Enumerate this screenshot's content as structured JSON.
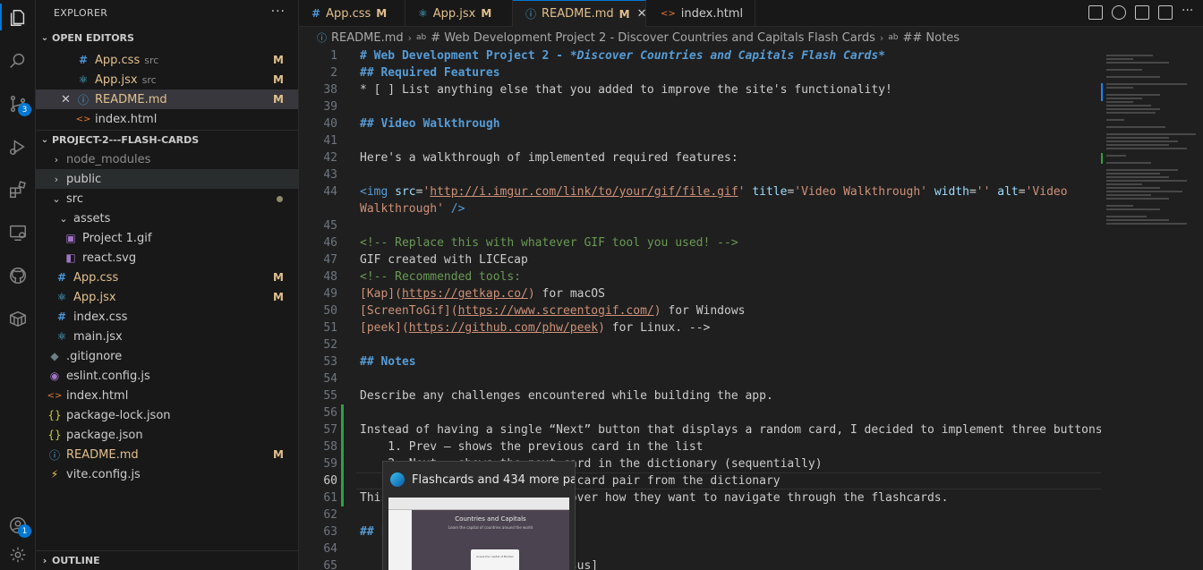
{
  "sidebar": {
    "title": "EXPLORER",
    "more": "···",
    "open_editors": {
      "title": "OPEN EDITORS",
      "items": [
        {
          "icon": "#",
          "label": "App.css",
          "desc": "src",
          "mark": "M"
        },
        {
          "icon": "⚛",
          "label": "App.jsx",
          "desc": "src",
          "mark": "M"
        },
        {
          "icon": "ⓘ",
          "label": "README.md",
          "desc": "",
          "mark": "M"
        },
        {
          "icon": "<>",
          "label": "index.html",
          "desc": "",
          "mark": ""
        }
      ]
    },
    "project": {
      "title": "PROJECT-2---FLASH-CARDS",
      "items": [
        {
          "label": "node_modules"
        },
        {
          "label": "public"
        },
        {
          "label": "src"
        },
        {
          "label": "assets"
        },
        {
          "label": "Project 1.gif"
        },
        {
          "label": "react.svg"
        },
        {
          "label": "App.css",
          "mark": "M"
        },
        {
          "label": "App.jsx",
          "mark": "M"
        },
        {
          "label": "index.css"
        },
        {
          "label": "main.jsx"
        },
        {
          "label": ".gitignore"
        },
        {
          "label": "eslint.config.js"
        },
        {
          "label": "index.html"
        },
        {
          "label": "package-lock.json"
        },
        {
          "label": "package.json"
        },
        {
          "label": "README.md",
          "mark": "M"
        },
        {
          "label": "vite.config.js"
        }
      ]
    },
    "outline": "OUTLINE"
  },
  "activity": {
    "scm_badge": "3",
    "account_badge": "1"
  },
  "tabs": [
    {
      "icon": "#",
      "label": "App.css",
      "mark": "M"
    },
    {
      "icon": "⚛",
      "label": "App.jsx",
      "mark": "M"
    },
    {
      "icon": "ⓘ",
      "label": "README.md",
      "mark": "M",
      "close": "✕"
    },
    {
      "icon": "<>",
      "label": "index.html",
      "mark": ""
    }
  ],
  "breadcrumb": {
    "file": "README.md",
    "h1": "# Web Development Project 2 - Discover Countries and Capitals Flash Cards",
    "h2": "## Notes",
    "sep": "›"
  },
  "editor": {
    "lines": [
      {
        "n": "1",
        "segs": [
          [
            "h",
            "# Web Development Project 2 - "
          ],
          [
            "it",
            "*Discover Countries and Capitals Flash Cards*"
          ]
        ]
      },
      {
        "n": "2",
        "segs": [
          [
            "h",
            "## Required Features"
          ]
        ]
      },
      {
        "n": "38",
        "segs": [
          [
            "",
            "* [ ] List anything else that you added to improve the site's functionality!"
          ]
        ]
      },
      {
        "n": "39",
        "segs": []
      },
      {
        "n": "40",
        "segs": [
          [
            "h",
            "## Video Walkthrough"
          ]
        ]
      },
      {
        "n": "41",
        "segs": []
      },
      {
        "n": "42",
        "segs": [
          [
            "",
            "Here's a walkthrough of implemented required features:"
          ]
        ]
      },
      {
        "n": "43",
        "segs": []
      },
      {
        "n": "44",
        "segs": [
          [
            "tag",
            "<img "
          ],
          [
            "attr",
            "src"
          ],
          [
            "",
            "="
          ],
          [
            "str",
            "'"
          ],
          [
            "url",
            "http://i.imgur.com/link/to/your/gif/file.gif"
          ],
          [
            "str",
            "'"
          ],
          [
            "",
            " "
          ],
          [
            "attr",
            "title"
          ],
          [
            "",
            "="
          ],
          [
            "str",
            "'Video Walkthrough'"
          ],
          [
            "",
            " "
          ],
          [
            "attr",
            "width"
          ],
          [
            "",
            "="
          ],
          [
            "str",
            "''"
          ],
          [
            "",
            " "
          ],
          [
            "attr",
            "alt"
          ],
          [
            "",
            "="
          ],
          [
            "str",
            "'Video"
          ]
        ]
      },
      {
        "n": "",
        "segs": [
          [
            "str",
            "Walkthrough'"
          ],
          [
            "tag",
            " />"
          ]
        ]
      },
      {
        "n": "45",
        "segs": []
      },
      {
        "n": "46",
        "segs": [
          [
            "cmt",
            "<!-- Replace this with whatever GIF tool you used! -->"
          ]
        ]
      },
      {
        "n": "47",
        "segs": [
          [
            "",
            "GIF created with LICEcap"
          ]
        ]
      },
      {
        "n": "48",
        "segs": [
          [
            "cmt",
            "<!-- Recommended tools:"
          ]
        ]
      },
      {
        "n": "49",
        "segs": [
          [
            "lk",
            "[Kap]("
          ],
          [
            "lu",
            "https://getkap.co/"
          ],
          [
            "lk",
            ")"
          ],
          [
            "",
            " for macOS"
          ]
        ]
      },
      {
        "n": "50",
        "segs": [
          [
            "lk",
            "[ScreenToGif]("
          ],
          [
            "lu",
            "https://www.screentogif.com/"
          ],
          [
            "lk",
            ")"
          ],
          [
            "",
            " for Windows"
          ]
        ]
      },
      {
        "n": "51",
        "segs": [
          [
            "lk",
            "[peek]("
          ],
          [
            "lu",
            "https://github.com/phw/peek"
          ],
          [
            "lk",
            ")"
          ],
          [
            "",
            " for Linux. -->"
          ]
        ]
      },
      {
        "n": "52",
        "segs": []
      },
      {
        "n": "53",
        "segs": [
          [
            "h",
            "## Notes"
          ]
        ]
      },
      {
        "n": "54",
        "segs": []
      },
      {
        "n": "55",
        "segs": [
          [
            "",
            "Describe any challenges encountered while building the app."
          ]
        ]
      },
      {
        "n": "56",
        "segs": []
      },
      {
        "n": "57",
        "segs": [
          [
            "",
            "Instead of having a single “Next” button that displays a random card, I decided to implement three buttons:"
          ]
        ]
      },
      {
        "n": "58",
        "segs": [
          [
            "",
            "    1. Prev – shows the previous card in the list"
          ]
        ]
      },
      {
        "n": "59",
        "segs": [
          [
            "",
            "    2. Next – shows the next card in the dictionary (sequentially)"
          ]
        ]
      },
      {
        "n": "60",
        "segs": [
          [
            "",
            "    3. Random – shows a random card pair from the dictionary"
          ]
        ]
      },
      {
        "n": "61",
        "segs": [
          [
            "",
            "This gives users more control over how they want to navigate through the flashcards."
          ]
        ]
      },
      {
        "n": "62",
        "segs": []
      },
      {
        "n": "63",
        "segs": [
          [
            "h",
            "## License"
          ]
        ]
      },
      {
        "n": "64",
        "segs": []
      },
      {
        "n": "65",
        "segs": [
          [
            "",
            "    Copyright [2025] [Codingjesus]"
          ]
        ]
      }
    ]
  },
  "hover_preview": {
    "title": "Flashcards and 434 more pa...",
    "page_title": "Countries and Capitals",
    "page_subtitle": "Learn the capital of countries around the world",
    "card_text": "Guess the capital of Bhutan"
  }
}
